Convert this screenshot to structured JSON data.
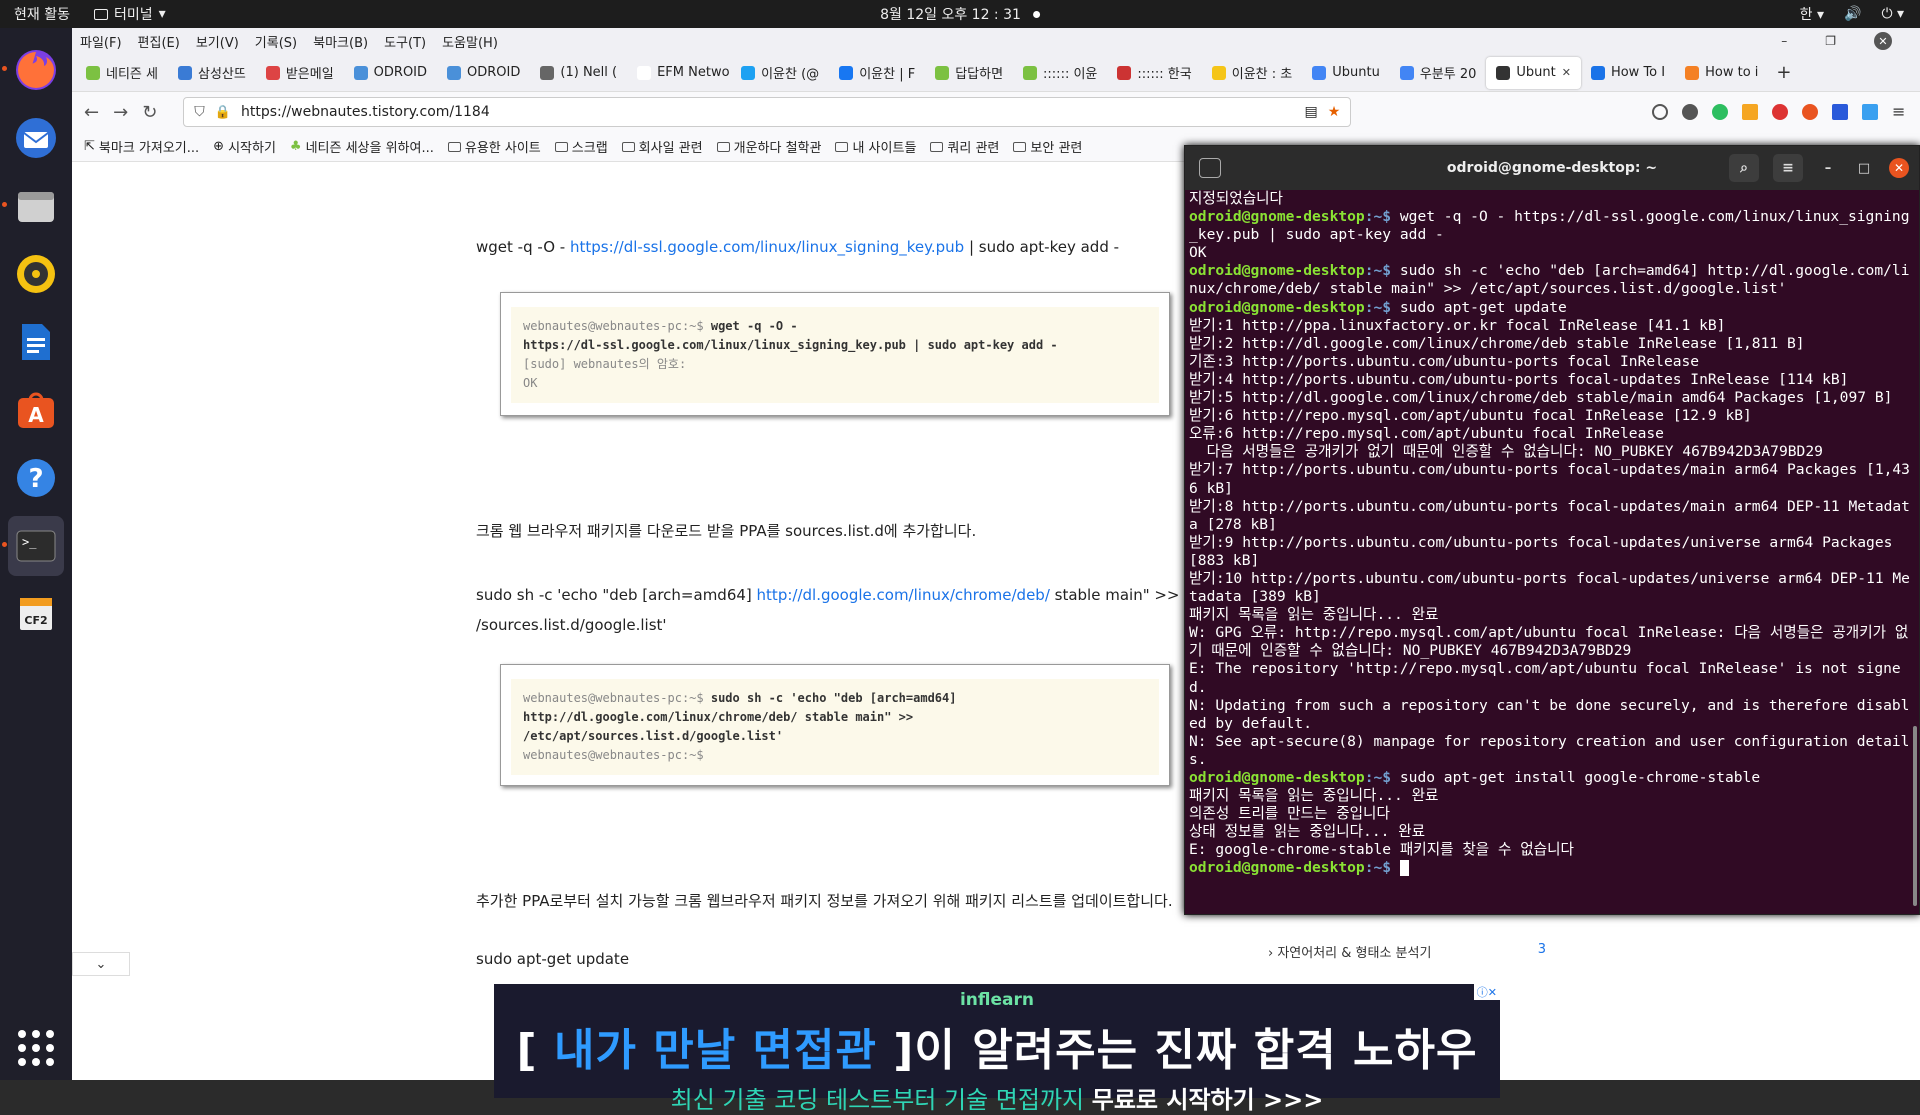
{
  "topbar": {
    "activities": "현재 활동",
    "app_name": "터미널",
    "clock": "8월 12일 오후 12 : 31",
    "lang": "한"
  },
  "dock": {
    "items": [
      "firefox-icon",
      "thunderbird-icon",
      "files-icon",
      "rhythmbox-icon",
      "writer-icon",
      "software-icon",
      "help-icon",
      "terminal-icon",
      "cf2-icon"
    ],
    "cf2_label": "CF2"
  },
  "browser": {
    "menu": [
      "파일(F)",
      "편집(E)",
      "보기(V)",
      "기록(S)",
      "북마크(B)",
      "도구(T)",
      "도움말(H)"
    ],
    "tabs": [
      {
        "label": "네티즌 세",
        "color": "#7cc142"
      },
      {
        "label": "삼성산뜨",
        "color": "#3a7bd5"
      },
      {
        "label": "받은메일",
        "color": "#d44"
      },
      {
        "label": "ODROID",
        "color": "#4a90d9"
      },
      {
        "label": "ODROID",
        "color": "#4a90d9"
      },
      {
        "label": "(1) Nell (",
        "color": "#666"
      },
      {
        "label": "EFM Netwo",
        "color": "#fff"
      },
      {
        "label": "이윤찬 (@",
        "color": "#1da1f2"
      },
      {
        "label": "이윤찬 | F",
        "color": "#1877f2"
      },
      {
        "label": "답답하면",
        "color": "#7cc142"
      },
      {
        "label": ":::::: 이윤",
        "color": "#7cc142"
      },
      {
        "label": ":::::: 한국",
        "color": "#c33"
      },
      {
        "label": "이윤찬 : 초",
        "color": "#f5c518"
      },
      {
        "label": "Ubuntu",
        "color": "#4285f4"
      },
      {
        "label": "우분투 20",
        "color": "#4285f4"
      },
      {
        "label": "Ubunt",
        "color": "#333"
      },
      {
        "label": "How To I",
        "color": "#1a73e8"
      },
      {
        "label": "How to i",
        "color": "#f48024"
      }
    ],
    "active_tab_index": 15,
    "url": "https://webnautes.tistory.com/1184",
    "bookmarks": [
      "북마크 가져오기...",
      "시작하기",
      "네티즌 세상을 위하여...",
      "유용한 사이트",
      "스크랩",
      "회사일 관련",
      "개운하다 철학관",
      "내 사이트들",
      "쿼리 관련",
      "보안 관련"
    ]
  },
  "article": {
    "p1_cmd": "wget -q -O - ",
    "p1_link": "https://dl-ssl.google.com/linux/linux_signing_key.pub",
    "p1_tail": " | sudo apt-key add -",
    "box1": {
      "prompt": "webnautes@webnautes-pc:~$ ",
      "cmd1": "wget -q -O -",
      "cmd2": "https://dl-ssl.google.com/linux/linux_signing_key.pub | sudo apt-key add -",
      "line3": "[sudo] webnautes의 암호:",
      "line4": "OK"
    },
    "p2": "크롬 웹 브라우저 패키지를 다운로드 받을 PPA를 sources.list.d에 추가합니다.",
    "p3_head": "sudo sh -c 'echo \"deb [arch=amd64] ",
    "p3_link": "http://dl.google.com/linux/chrome/deb/",
    "p3_tail": " stable main\" >> /etc/apt",
    "p3_line2": "/sources.list.d/google.list'",
    "box2": {
      "prompt": "webnautes@webnautes-pc:~$ ",
      "cmd1": "sudo sh -c 'echo \"deb [arch=amd64]",
      "cmd2": "http://dl.google.com/linux/chrome/deb/ stable main\" >>",
      "cmd3": "/etc/apt/sources.list.d/google.list'",
      "line4": "webnautes@webnautes-pc:~$"
    },
    "p4": "추가한 PPA로부터 설치 가능할 크롬 웹브라우저 패키지 정보를 가져오기 위해 패키지 리스트를 업데이트합니다.",
    "p5": "sudo apt-get update"
  },
  "sidebar_category": {
    "label": "자연어처리 & 형태소 분석기",
    "count": "3"
  },
  "ad": {
    "brand": "inflearn",
    "head_open": "[ ",
    "head_hl": "내가 만날 면접관",
    "head_rest": " ]이 알려주는 진짜 합격 노하우",
    "sub": "최신 기출 코딩 테스트부터 기술 면접까지 ",
    "cta": "무료로 시작하기 >>>"
  },
  "terminal": {
    "title": "odroid@gnome-desktop: ~",
    "user": "odroid@gnome-desktop",
    "path": ":~$",
    "lines": [
      {
        "t": "out",
        "s": "지정되었습니다"
      },
      {
        "t": "cmd",
        "s": " wget -q -O - https://dl-ssl.google.com/linux/linux_signing_key.pub | sudo apt-key add -"
      },
      {
        "t": "out",
        "s": "OK"
      },
      {
        "t": "cmd",
        "s": " sudo sh -c 'echo \"deb [arch=amd64] http://dl.google.com/linux/chrome/deb/ stable main\" >> /etc/apt/sources.list.d/google.list'"
      },
      {
        "t": "cmd",
        "s": " sudo apt-get update"
      },
      {
        "t": "out",
        "s": "받기:1 http://ppa.linuxfactory.or.kr focal InRelease [41.1 kB]"
      },
      {
        "t": "out",
        "s": "받기:2 http://dl.google.com/linux/chrome/deb stable InRelease [1,811 B]"
      },
      {
        "t": "out",
        "s": "기존:3 http://ports.ubuntu.com/ubuntu-ports focal InRelease"
      },
      {
        "t": "out",
        "s": "받기:4 http://ports.ubuntu.com/ubuntu-ports focal-updates InRelease [114 kB]"
      },
      {
        "t": "out",
        "s": "받기:5 http://dl.google.com/linux/chrome/deb stable/main amd64 Packages [1,097 B]"
      },
      {
        "t": "out",
        "s": "받기:6 http://repo.mysql.com/apt/ubuntu focal InRelease [12.9 kB]"
      },
      {
        "t": "out",
        "s": "오류:6 http://repo.mysql.com/apt/ubuntu focal InRelease"
      },
      {
        "t": "out",
        "s": "  다음 서명들은 공개키가 없기 때문에 인증할 수 없습니다: NO_PUBKEY 467B942D3A79BD29"
      },
      {
        "t": "out",
        "s": "받기:7 http://ports.ubuntu.com/ubuntu-ports focal-updates/main arm64 Packages [1,436 kB]"
      },
      {
        "t": "out",
        "s": "받기:8 http://ports.ubuntu.com/ubuntu-ports focal-updates/main arm64 DEP-11 Metadata [278 kB]"
      },
      {
        "t": "out",
        "s": "받기:9 http://ports.ubuntu.com/ubuntu-ports focal-updates/universe arm64 Packages [883 kB]"
      },
      {
        "t": "out",
        "s": "받기:10 http://ports.ubuntu.com/ubuntu-ports focal-updates/universe arm64 DEP-11 Metadata [389 kB]"
      },
      {
        "t": "out",
        "s": "패키지 목록을 읽는 중입니다... 완료"
      },
      {
        "t": "out",
        "s": "W: GPG 오류: http://repo.mysql.com/apt/ubuntu focal InRelease: 다음 서명들은 공개키가 없기 때문에 인증할 수 없습니다: NO_PUBKEY 467B942D3A79BD29"
      },
      {
        "t": "out",
        "s": "E: The repository 'http://repo.mysql.com/apt/ubuntu focal InRelease' is not signed."
      },
      {
        "t": "out",
        "s": "N: Updating from such a repository can't be done securely, and is therefore disabled by default."
      },
      {
        "t": "out",
        "s": "N: See apt-secure(8) manpage for repository creation and user configuration details."
      },
      {
        "t": "cmd",
        "s": " sudo apt-get install google-chrome-stable"
      },
      {
        "t": "out",
        "s": "패키지 목록을 읽는 중입니다... 완료"
      },
      {
        "t": "out",
        "s": "의존성 트리를 만드는 중입니다"
      },
      {
        "t": "out",
        "s": "상태 정보를 읽는 중입니다... 완료"
      },
      {
        "t": "out",
        "s": "E: google-chrome-stable 패키지를 찾을 수 없습니다"
      },
      {
        "t": "prompt",
        "s": " "
      }
    ]
  }
}
